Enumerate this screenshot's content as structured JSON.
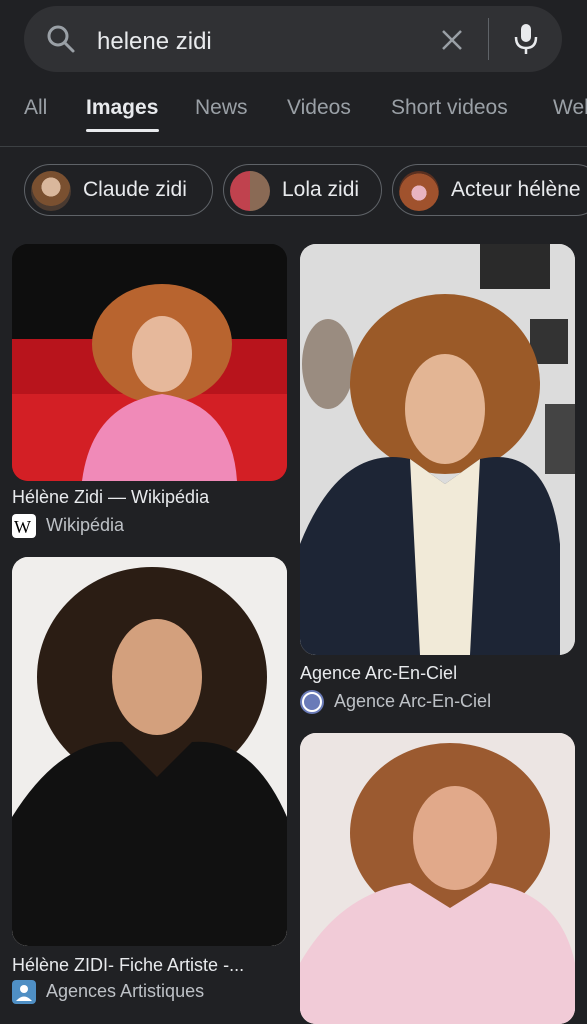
{
  "search": {
    "query": "helene zidi"
  },
  "tabs": [
    {
      "label": "All"
    },
    {
      "label": "Images",
      "active": true
    },
    {
      "label": "News"
    },
    {
      "label": "Videos"
    },
    {
      "label": "Short videos"
    },
    {
      "label": "Web"
    }
  ],
  "chips": [
    {
      "label": "Claude zidi"
    },
    {
      "label": "Lola zidi"
    },
    {
      "label": "Acteur hélène"
    }
  ],
  "results": [
    {
      "title": "Hélène Zidi — Wikipédia",
      "source": "Wikipédia",
      "source_icon": "wikipedia-icon"
    },
    {
      "title": "Agence Arc-En-Ciel",
      "source": "Agence Arc-En-Ciel",
      "source_icon": "globe-icon"
    },
    {
      "title": "Hélène ZIDI- Fiche Artiste -...",
      "source": "Agences Artistiques",
      "source_icon": "person-icon"
    },
    {
      "title": "",
      "source": "",
      "source_icon": ""
    }
  ],
  "colors": {
    "background": "#202124",
    "search_bar": "#303134",
    "text_primary": "#e8eaed",
    "text_secondary": "#9aa0a6"
  }
}
